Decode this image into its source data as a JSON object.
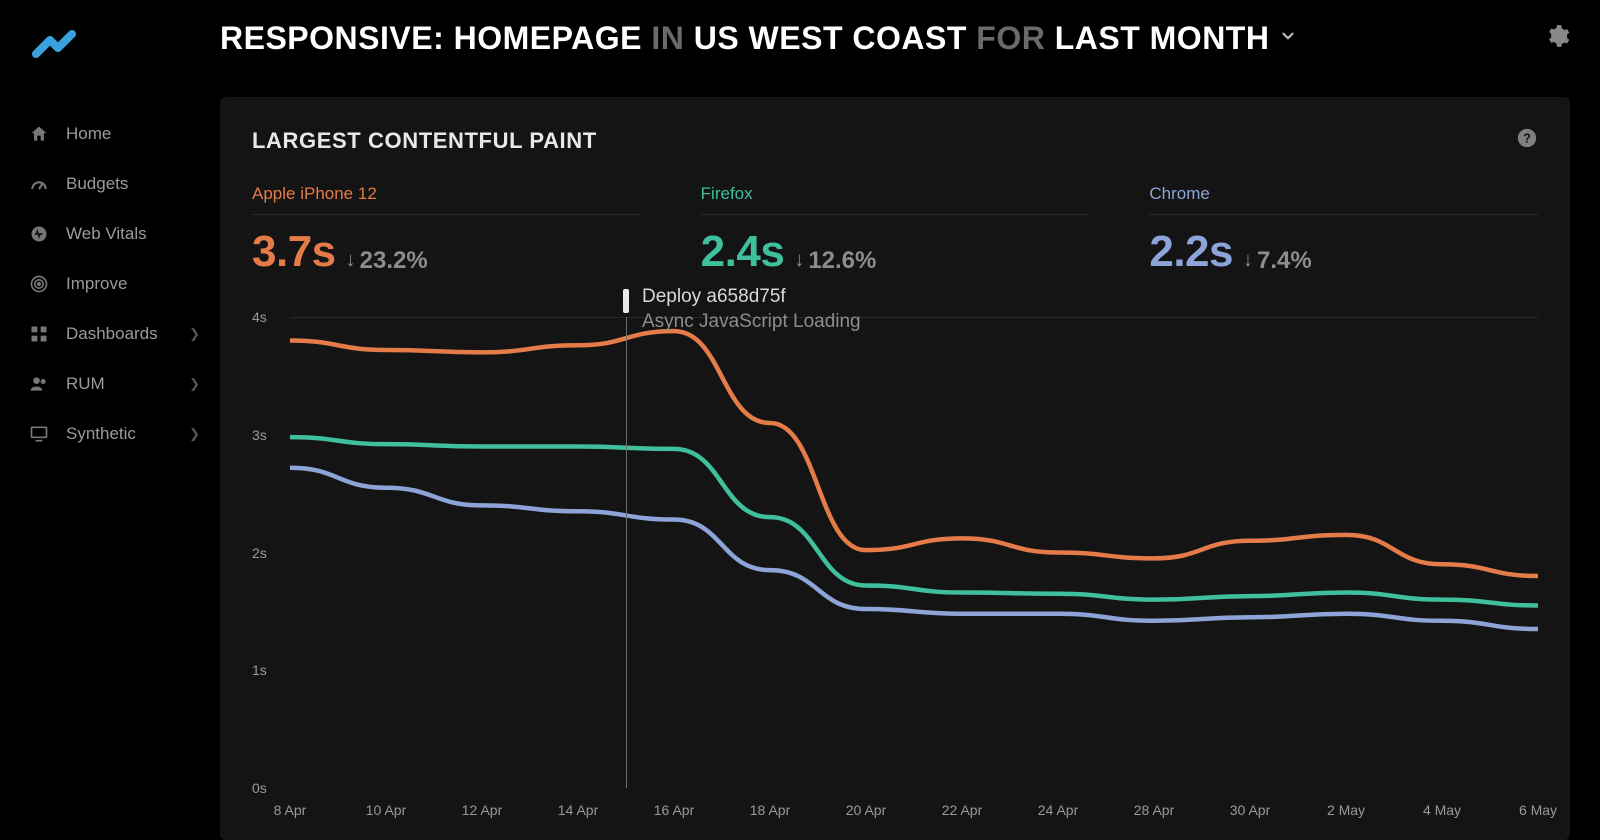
{
  "sidebar": {
    "items": [
      {
        "label": "Home",
        "icon": "home-icon",
        "expandable": false
      },
      {
        "label": "Budgets",
        "icon": "gauge-icon",
        "expandable": false
      },
      {
        "label": "Web Vitals",
        "icon": "vitals-icon",
        "expandable": false
      },
      {
        "label": "Improve",
        "icon": "target-icon",
        "expandable": false
      },
      {
        "label": "Dashboards",
        "icon": "grid-icon",
        "expandable": true
      },
      {
        "label": "RUM",
        "icon": "users-icon",
        "expandable": true
      },
      {
        "label": "Synthetic",
        "icon": "monitor-icon",
        "expandable": true
      }
    ]
  },
  "header": {
    "seg1": "Responsive: Homepage",
    "seg2_dim": "in",
    "seg3": "US West Coast",
    "seg4_dim": "for",
    "seg5": "last month"
  },
  "card": {
    "title": "LARGEST CONTENTFUL PAINT"
  },
  "metrics": [
    {
      "label": "Apple iPhone 12",
      "value": "3.7s",
      "delta": "23.2%",
      "dir": "down",
      "color": "c-orange"
    },
    {
      "label": "Firefox",
      "value": "2.4s",
      "delta": "12.6%",
      "dir": "down",
      "color": "c-green"
    },
    {
      "label": "Chrome",
      "value": "2.2s",
      "delta": "7.4%",
      "dir": "down",
      "color": "c-blue"
    }
  ],
  "deploy": {
    "title": "Deploy a658d75f",
    "subtitle": "Async JavaScript Loading"
  },
  "chart_data": {
    "type": "line",
    "title": "Largest Contentful Paint",
    "xlabel": "",
    "ylabel": "",
    "ylim": [
      0,
      4
    ],
    "y_ticks": [
      "0s",
      "1s",
      "2s",
      "3s",
      "4s"
    ],
    "x_ticks": [
      "8 Apr",
      "10 Apr",
      "12 Apr",
      "14 Apr",
      "16 Apr",
      "18 Apr",
      "20 Apr",
      "22 Apr",
      "24 Apr",
      "28 Apr",
      "30 Apr",
      "2 May",
      "4 May",
      "6 May"
    ],
    "x": [
      "8 Apr",
      "10 Apr",
      "12 Apr",
      "14 Apr",
      "16 Apr",
      "18 Apr",
      "20 Apr",
      "22 Apr",
      "24 Apr",
      "28 Apr",
      "30 Apr",
      "2 May",
      "4 May",
      "6 May"
    ],
    "series": [
      {
        "name": "Apple iPhone 12",
        "color": "#e57b49",
        "values": [
          3.8,
          3.72,
          3.7,
          3.76,
          3.88,
          3.1,
          2.02,
          2.12,
          2.0,
          1.95,
          2.1,
          2.15,
          1.9,
          1.8
        ]
      },
      {
        "name": "Firefox",
        "color": "#3fbf9c",
        "values": [
          2.98,
          2.92,
          2.9,
          2.9,
          2.88,
          2.3,
          1.72,
          1.66,
          1.65,
          1.6,
          1.63,
          1.66,
          1.6,
          1.55
        ]
      },
      {
        "name": "Chrome",
        "color": "#8ca4d8",
        "values": [
          2.72,
          2.55,
          2.4,
          2.35,
          2.28,
          1.85,
          1.52,
          1.48,
          1.48,
          1.42,
          1.45,
          1.48,
          1.42,
          1.35
        ]
      }
    ],
    "annotations": [
      {
        "x_between": [
          "14 Apr",
          "16 Apr"
        ],
        "fraction": 0.5,
        "label": "Deploy a658d75f",
        "sublabel": "Async JavaScript Loading"
      }
    ]
  }
}
